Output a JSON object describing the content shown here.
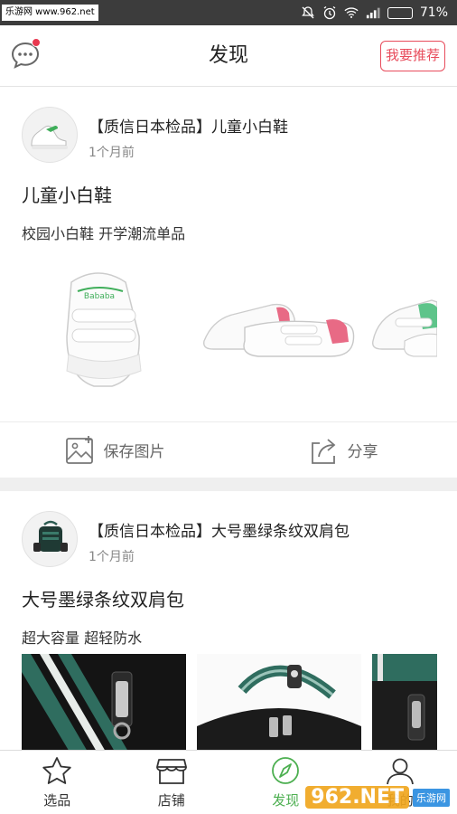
{
  "status_bar": {
    "watermark": "乐游网 www.962.net",
    "battery": "71%",
    "battery_level": 0.71,
    "icons": [
      "mute-icon",
      "alarm-icon",
      "wifi-icon",
      "signal-icon",
      "battery-icon"
    ]
  },
  "header": {
    "title": "发现",
    "recommend_label": "我要推荐",
    "accent": "#e84c5c"
  },
  "posts": [
    {
      "title": "【质信日本检品】儿童小白鞋",
      "time": "1个月前",
      "headline": "儿童小白鞋",
      "subtitle": "校园小白鞋 开学潮流单品",
      "image_brand_text": "Bababa",
      "save_label": "保存图片",
      "share_label": "分享"
    },
    {
      "title": "【质信日本检品】大号墨绿条纹双肩包",
      "time": "1个月前",
      "headline": "大号墨绿条纹双肩包",
      "subtitle": "超大容量 超轻防水"
    }
  ],
  "tabs": [
    {
      "label": "选品",
      "icon": "star-icon"
    },
    {
      "label": "店铺",
      "icon": "shop-icon"
    },
    {
      "label": "发现",
      "icon": "compass-icon",
      "active": true
    },
    {
      "label": "我的",
      "icon": "user-icon"
    }
  ],
  "active_color": "#4caf50",
  "watermark_bottom": {
    "logo": "962.NET",
    "sub": "乐游网"
  }
}
